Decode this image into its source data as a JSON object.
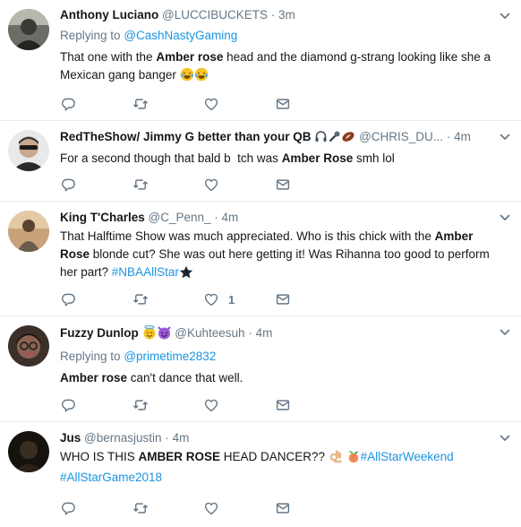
{
  "tweets": [
    {
      "name": "Anthony Luciano",
      "handle": "@LUCCIBUCKETS",
      "sep": "·",
      "time": "3m",
      "reply_prefix": "Replying to",
      "reply_target": "@CashNastyGaming",
      "text_1": "That one with the ",
      "bold_1": "Amber rose",
      "text_2": " head and the diamond g-strang looking like she a Mexican gang banger ",
      "like_count": ""
    },
    {
      "name": "RedTheShow/ Jimmy G better than your QB",
      "handle": "@CHRIS_DU...",
      "sep": "·",
      "time": "4m",
      "text_1": "For a second though that bald b",
      "text_gap": "  ",
      "text_2": "tch was ",
      "bold_1": "Amber Rose",
      "text_3": " smh lol",
      "like_count": ""
    },
    {
      "name": "King T'Charles",
      "handle": "@C_Penn_",
      "sep": "·",
      "time": "4m",
      "text_1": "That Halftime Show was much appreciated. Who is this chick with the ",
      "bold_1": "Amber Rose",
      "text_2": " blonde cut? She was out here getting it! Was Rihanna too good to perform her part? ",
      "hashtag": "#NBAAllStar",
      "like_count": "1"
    },
    {
      "name": "Fuzzy Dunlop",
      "handle": "@Kuhteesuh",
      "sep": "·",
      "time": "4m",
      "reply_prefix": "Replying to",
      "reply_target": "@primetime2832",
      "bold_1": "Amber rose",
      "text_1": " can't dance that well.",
      "like_count": ""
    },
    {
      "name": "Jus",
      "handle": "@bernasjustin",
      "sep": "·",
      "time": "4m",
      "text_1": "WHO IS THIS ",
      "bold_1": "AMBER ROSE",
      "text_2": " HEAD DANCER?? ",
      "hashtag_1": "#AllStarWeekend",
      "hashtag_2": "#AllStarGame2018",
      "like_count": ""
    }
  ],
  "icons": {
    "reply": "reply-icon",
    "retweet": "retweet-icon",
    "like": "heart-icon",
    "dm": "envelope-icon",
    "caret": "chevron-down-icon"
  },
  "colors": {
    "accent": "#1b95e0",
    "muted": "#657786",
    "text": "#14171a",
    "border": "#e6ecf0",
    "icon": "#657786"
  }
}
